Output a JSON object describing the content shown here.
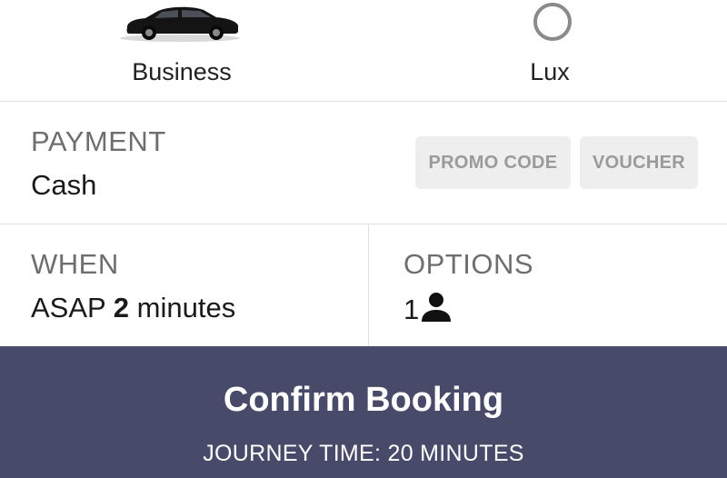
{
  "vehicles": {
    "business": {
      "label": "Business",
      "icon": "car-icon"
    },
    "lux": {
      "label": "Lux",
      "icon": "radio-unselected-icon"
    }
  },
  "payment": {
    "heading": "PAYMENT",
    "method": "Cash",
    "promo_label": "PROMO CODE",
    "voucher_label": "VOUCHER"
  },
  "when": {
    "heading": "WHEN",
    "prefix": "ASAP",
    "minutes": "2",
    "suffix": "minutes"
  },
  "options": {
    "heading": "OPTIONS",
    "passengers": "1",
    "icon": "person-icon"
  },
  "confirm": {
    "label": "Confirm Booking",
    "journey_time": "JOURNEY TIME: 20 MINUTES",
    "background": "#474a69"
  }
}
